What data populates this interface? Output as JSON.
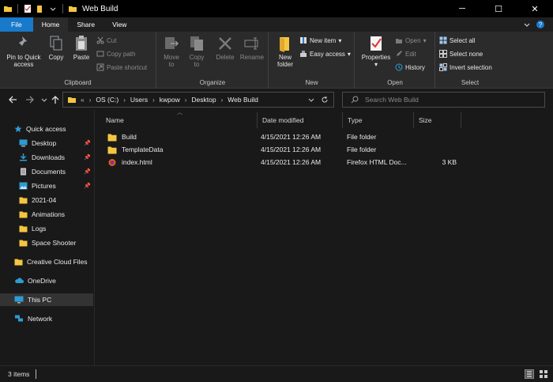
{
  "window": {
    "title": "Web Build",
    "controls": {
      "minimize": "─",
      "maximize": "☐",
      "close": "✕"
    }
  },
  "ribbon_tabs": [
    "File",
    "Home",
    "Share",
    "View"
  ],
  "ribbon": {
    "clipboard": {
      "label": "Clipboard",
      "pin": "Pin to Quick\naccess",
      "copy": "Copy",
      "paste": "Paste",
      "cut": "Cut",
      "copy_path": "Copy path",
      "paste_shortcut": "Paste shortcut"
    },
    "organize": {
      "label": "Organize",
      "move_to": "Move\nto",
      "copy_to": "Copy\nto",
      "delete": "Delete",
      "rename": "Rename"
    },
    "new": {
      "label": "New",
      "new_folder": "New\nfolder",
      "new_item": "New item",
      "easy_access": "Easy access"
    },
    "open": {
      "label": "Open",
      "properties": "Properties",
      "open": "Open",
      "edit": "Edit",
      "history": "History"
    },
    "select": {
      "label": "Select",
      "select_all": "Select all",
      "select_none": "Select none",
      "invert": "Invert selection"
    }
  },
  "address": {
    "overflow": "«",
    "breadcrumbs": [
      "OS (C:)",
      "Users",
      "kwpow",
      "Desktop",
      "Web Build"
    ]
  },
  "search": {
    "placeholder": "Search Web Build"
  },
  "navpane": {
    "quick_access": "Quick access",
    "items": [
      {
        "label": "Desktop",
        "pinned": true
      },
      {
        "label": "Downloads",
        "pinned": true
      },
      {
        "label": "Documents",
        "pinned": true
      },
      {
        "label": "Pictures",
        "pinned": true
      },
      {
        "label": "2021-04",
        "pinned": false
      },
      {
        "label": "Animations",
        "pinned": false
      },
      {
        "label": "Logs",
        "pinned": false
      },
      {
        "label": "Space Shooter",
        "pinned": false
      }
    ],
    "creative_cloud": "Creative Cloud Files",
    "onedrive": "OneDrive",
    "this_pc": "This PC",
    "network": "Network"
  },
  "columns": [
    "Name",
    "Date modified",
    "Type",
    "Size"
  ],
  "files": [
    {
      "name": "Build",
      "date": "4/15/2021 12:26 AM",
      "type": "File folder",
      "size": "",
      "kind": "folder"
    },
    {
      "name": "TemplateData",
      "date": "4/15/2021 12:26 AM",
      "type": "File folder",
      "size": "",
      "kind": "folder"
    },
    {
      "name": "index.html",
      "date": "4/15/2021 12:26 AM",
      "type": "Firefox HTML Doc...",
      "size": "3 KB",
      "kind": "html"
    }
  ],
  "status": {
    "count": "3 items"
  },
  "colors": {
    "accent": "#1979ca",
    "folder": "#f5c542",
    "background": "#191919"
  }
}
